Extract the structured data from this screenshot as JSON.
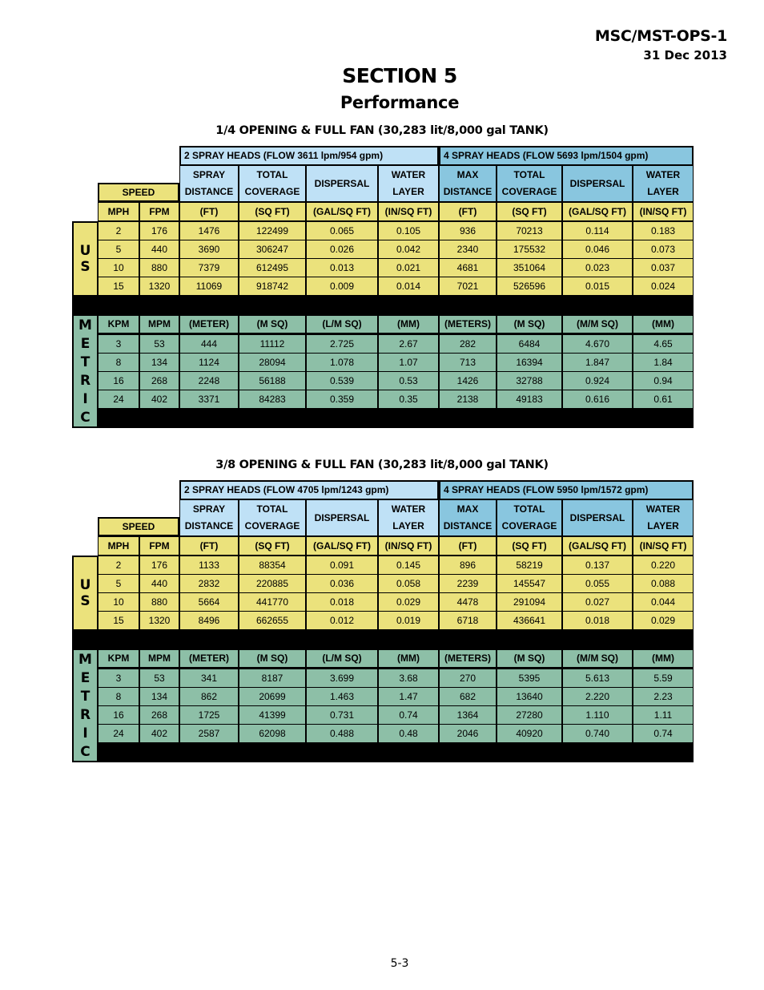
{
  "document": {
    "id": "MSC/MST-OPS-1",
    "date": "31 Dec 2013",
    "section": "SECTION 5",
    "section_title": "Performance",
    "page_number": "5-3"
  },
  "tables": [
    {
      "title": "1/4 OPENING & FULL FAN (30,283 lit/8,000 gal TANK)",
      "group1": "2 SPRAY HEADS (FLOW 3611 lpm/954 gpm)",
      "group2": "4 SPRAY HEADS (FLOW 5693 lpm/1504 gpm)",
      "speed_label": "SPEED",
      "col_headers": [
        [
          "SPRAY",
          "DISTANCE"
        ],
        [
          "TOTAL",
          "COVERAGE"
        ],
        [
          "DISPERSAL",
          ""
        ],
        [
          "WATER",
          "LAYER"
        ],
        [
          "MAX",
          "DISTANCE"
        ],
        [
          "TOTAL",
          "COVERAGE"
        ],
        [
          "DISPERSAL",
          ""
        ],
        [
          "WATER",
          "LAYER"
        ]
      ],
      "us_units": [
        "MPH",
        "FPM",
        "(FT)",
        "(SQ FT)",
        "(GAL/SQ FT)",
        "(IN/SQ FT)",
        "(FT)",
        "(SQ FT)",
        "(GAL/SQ FT)",
        "(IN/SQ FT)"
      ],
      "us_label": [
        "U",
        "S"
      ],
      "us_rows": [
        [
          "2",
          "176",
          "1476",
          "122499",
          "0.065",
          "0.105",
          "936",
          "70213",
          "0.114",
          "0.183"
        ],
        [
          "5",
          "440",
          "3690",
          "306247",
          "0.026",
          "0.042",
          "2340",
          "175532",
          "0.046",
          "0.073"
        ],
        [
          "10",
          "880",
          "7379",
          "612495",
          "0.013",
          "0.021",
          "4681",
          "351064",
          "0.023",
          "0.037"
        ],
        [
          "15",
          "1320",
          "11069",
          "918742",
          "0.009",
          "0.014",
          "7021",
          "526596",
          "0.015",
          "0.024"
        ]
      ],
      "metric_units": [
        "KPM",
        "MPM",
        "(METER)",
        "(M SQ)",
        "(L/M SQ)",
        "(MM)",
        "(METERS)",
        "(M SQ)",
        "(M/M SQ)",
        "(MM)"
      ],
      "metric_label": [
        "M",
        "E",
        "T",
        "R",
        "I",
        "C"
      ],
      "metric_rows": [
        [
          "3",
          "53",
          "444",
          "11112",
          "2.725",
          "2.67",
          "282",
          "6484",
          "4.670",
          "4.65"
        ],
        [
          "8",
          "134",
          "1124",
          "28094",
          "1.078",
          "1.07",
          "713",
          "16394",
          "1.847",
          "1.84"
        ],
        [
          "16",
          "268",
          "2248",
          "56188",
          "0.539",
          "0.53",
          "1426",
          "32788",
          "0.924",
          "0.94"
        ],
        [
          "24",
          "402",
          "3371",
          "84283",
          "0.359",
          "0.35",
          "2138",
          "49183",
          "0.616",
          "0.61"
        ]
      ]
    },
    {
      "title": "3/8 OPENING & FULL FAN (30,283 lit/8,000 gal TANK)",
      "group1": "2 SPRAY HEADS (FLOW 4705 lpm/1243 gpm)",
      "group2": "4 SPRAY HEADS (FLOW 5950 lpm/1572 gpm)",
      "speed_label": "SPEED",
      "col_headers": [
        [
          "SPRAY",
          "DISTANCE"
        ],
        [
          "TOTAL",
          "COVERAGE"
        ],
        [
          "DISPERSAL",
          ""
        ],
        [
          "WATER",
          "LAYER"
        ],
        [
          "MAX",
          "DISTANCE"
        ],
        [
          "TOTAL",
          "COVERAGE"
        ],
        [
          "DISPERSAL",
          ""
        ],
        [
          "WATER",
          "LAYER"
        ]
      ],
      "us_units": [
        "MPH",
        "FPM",
        "(FT)",
        "(SQ FT)",
        "(GAL/SQ FT)",
        "(IN/SQ FT)",
        "(FT)",
        "(SQ FT)",
        "(GAL/SQ FT)",
        "(IN/SQ FT)"
      ],
      "us_label": [
        "U",
        "S"
      ],
      "us_rows": [
        [
          "2",
          "176",
          "1133",
          "88354",
          "0.091",
          "0.145",
          "896",
          "58219",
          "0.137",
          "0.220"
        ],
        [
          "5",
          "440",
          "2832",
          "220885",
          "0.036",
          "0.058",
          "2239",
          "145547",
          "0.055",
          "0.088"
        ],
        [
          "10",
          "880",
          "5664",
          "441770",
          "0.018",
          "0.029",
          "4478",
          "291094",
          "0.027",
          "0.044"
        ],
        [
          "15",
          "1320",
          "8496",
          "662655",
          "0.012",
          "0.019",
          "6718",
          "436641",
          "0.018",
          "0.029"
        ]
      ],
      "metric_units": [
        "KPM",
        "MPM",
        "(METER)",
        "(M SQ)",
        "(L/M SQ)",
        "(MM)",
        "(METERS)",
        "(M SQ)",
        "(M/M SQ)",
        "(MM)"
      ],
      "metric_label": [
        "M",
        "E",
        "T",
        "R",
        "I",
        "C"
      ],
      "metric_rows": [
        [
          "3",
          "53",
          "341",
          "8187",
          "3.699",
          "3.68",
          "270",
          "5395",
          "5.613",
          "5.59"
        ],
        [
          "8",
          "134",
          "862",
          "20699",
          "1.463",
          "1.47",
          "682",
          "13640",
          "2.220",
          "2.23"
        ],
        [
          "16",
          "268",
          "1725",
          "41399",
          "0.731",
          "0.74",
          "1364",
          "27280",
          "1.110",
          "1.11"
        ],
        [
          "24",
          "402",
          "2587",
          "62098",
          "0.488",
          "0.48",
          "2046",
          "40920",
          "0.740",
          "0.74"
        ]
      ]
    }
  ]
}
